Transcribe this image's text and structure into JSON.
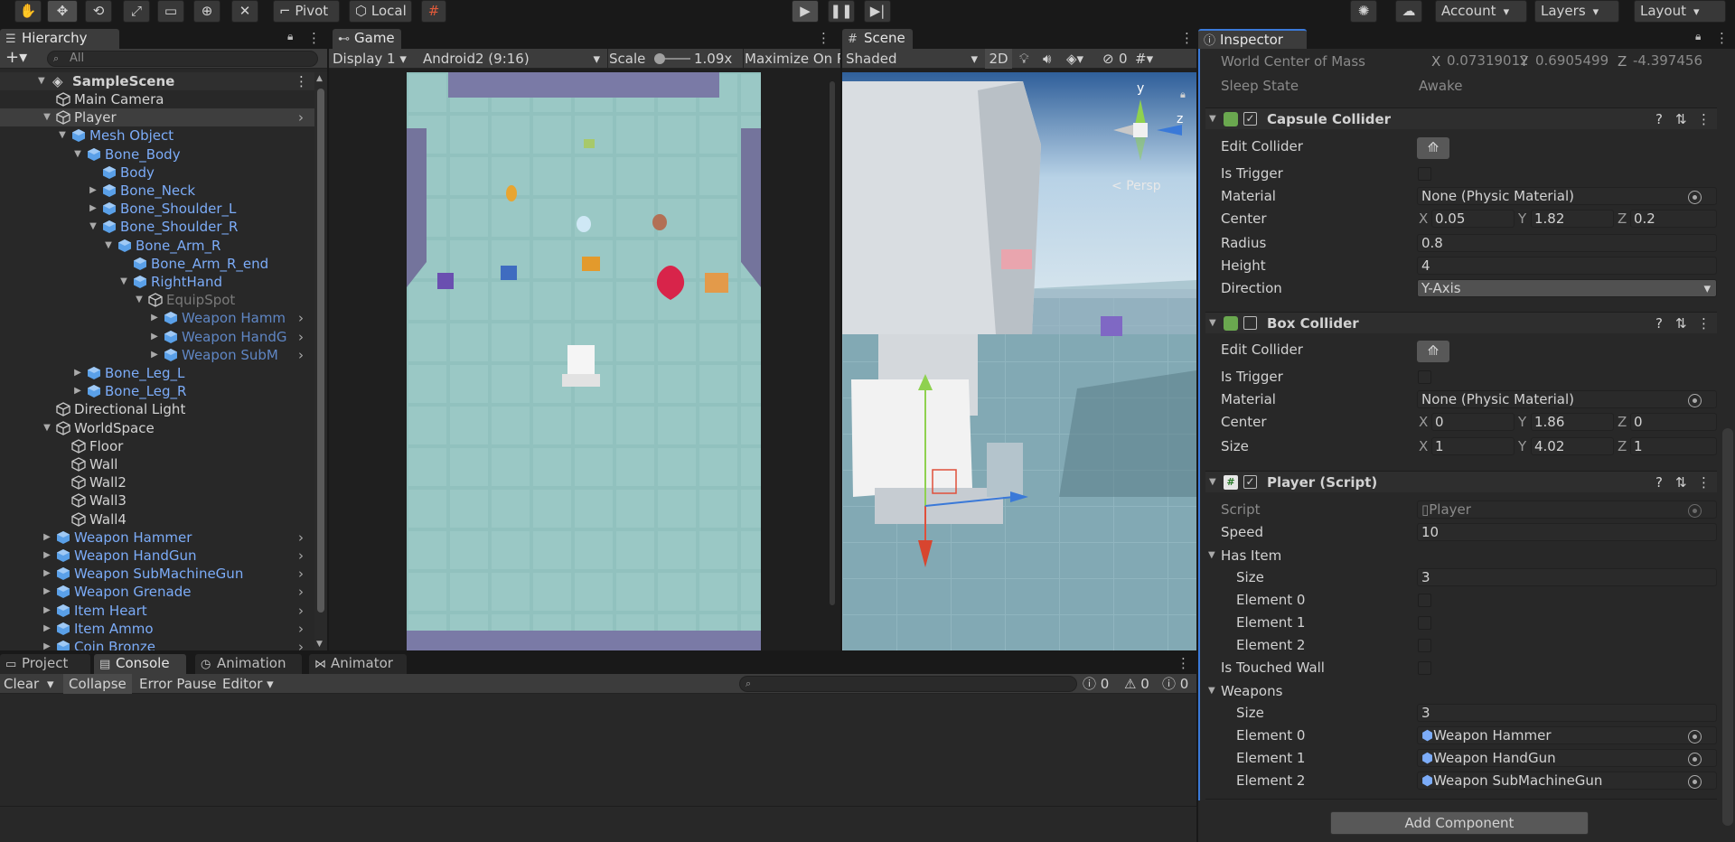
{
  "toolbar": {
    "pivot": "Pivot",
    "local": "Local",
    "account": "Account",
    "layers": "Layers",
    "layout": "Layout"
  },
  "hierarchy": {
    "tab": "Hierarchy",
    "search_placeholder": "All",
    "scene": "SampleScene",
    "rows": [
      {
        "label": "Main Camera",
        "depth": 0,
        "fold": "",
        "color": "white",
        "more": false
      },
      {
        "label": "Player",
        "depth": 0,
        "fold": "open",
        "color": "white",
        "more": true,
        "selected": true
      },
      {
        "label": "Mesh Object",
        "depth": 1,
        "fold": "open",
        "color": "blue",
        "more": false
      },
      {
        "label": "Bone_Body",
        "depth": 2,
        "fold": "open",
        "color": "blue",
        "more": false
      },
      {
        "label": "Body",
        "depth": 3,
        "fold": "",
        "color": "blue",
        "more": false
      },
      {
        "label": "Bone_Neck",
        "depth": 3,
        "fold": "closed",
        "color": "blue",
        "more": false
      },
      {
        "label": "Bone_Shoulder_L",
        "depth": 3,
        "fold": "closed",
        "color": "blue",
        "more": false
      },
      {
        "label": "Bone_Shoulder_R",
        "depth": 3,
        "fold": "open",
        "color": "blue",
        "more": false
      },
      {
        "label": "Bone_Arm_R",
        "depth": 4,
        "fold": "open",
        "color": "blue",
        "more": false
      },
      {
        "label": "Bone_Arm_R_end",
        "depth": 5,
        "fold": "",
        "color": "blue",
        "more": false
      },
      {
        "label": "RightHand",
        "depth": 5,
        "fold": "open",
        "color": "blue",
        "more": false
      },
      {
        "label": "EquipSpot",
        "depth": 6,
        "fold": "open",
        "color": "dim",
        "more": false
      },
      {
        "label": "Weapon Hamm",
        "depth": 7,
        "fold": "closed",
        "color": "bluedim",
        "more": true
      },
      {
        "label": "Weapon HandG",
        "depth": 7,
        "fold": "closed",
        "color": "bluedim",
        "more": true
      },
      {
        "label": "Weapon SubM",
        "depth": 7,
        "fold": "closed",
        "color": "bluedim",
        "more": true
      },
      {
        "label": "Bone_Leg_L",
        "depth": 2,
        "fold": "closed",
        "color": "blue",
        "more": false
      },
      {
        "label": "Bone_Leg_R",
        "depth": 2,
        "fold": "closed",
        "color": "blue",
        "more": false
      },
      {
        "label": "Directional Light",
        "depth": 0,
        "fold": "",
        "color": "white",
        "more": false
      },
      {
        "label": "WorldSpace",
        "depth": 0,
        "fold": "open",
        "color": "white",
        "more": false
      },
      {
        "label": "Floor",
        "depth": 1,
        "fold": "",
        "color": "white",
        "more": false
      },
      {
        "label": "Wall",
        "depth": 1,
        "fold": "",
        "color": "white",
        "more": false
      },
      {
        "label": "Wall2",
        "depth": 1,
        "fold": "",
        "color": "white",
        "more": false
      },
      {
        "label": "Wall3",
        "depth": 1,
        "fold": "",
        "color": "white",
        "more": false
      },
      {
        "label": "Wall4",
        "depth": 1,
        "fold": "",
        "color": "white",
        "more": false
      },
      {
        "label": "Weapon Hammer",
        "depth": 0,
        "fold": "closed",
        "color": "blue",
        "more": true
      },
      {
        "label": "Weapon HandGun",
        "depth": 0,
        "fold": "closed",
        "color": "blue",
        "more": true
      },
      {
        "label": "Weapon SubMachineGun",
        "depth": 0,
        "fold": "closed",
        "color": "blue",
        "more": true
      },
      {
        "label": "Weapon Grenade",
        "depth": 0,
        "fold": "closed",
        "color": "blue",
        "more": true
      },
      {
        "label": "Item Heart",
        "depth": 0,
        "fold": "closed",
        "color": "blue",
        "more": true
      },
      {
        "label": "Item Ammo",
        "depth": 0,
        "fold": "closed",
        "color": "blue",
        "more": true
      },
      {
        "label": "Coin Bronze",
        "depth": 0,
        "fold": "closed",
        "color": "blue",
        "more": true
      }
    ]
  },
  "game": {
    "tab": "Game",
    "display": "Display 1",
    "aspect": "Android2 (9:16)",
    "scale_label": "Scale",
    "scale_value": "1.09x",
    "maximize": "Maximize On P"
  },
  "scene_view": {
    "tab": "Scene",
    "shading": "Shaded",
    "mode_2d": "2D",
    "hidden_count": "0",
    "persp": "Persp",
    "axis_y": "y",
    "axis_z": "z"
  },
  "inspector": {
    "tab": "Inspector",
    "world_com_label": "World Center of Mass",
    "world_com": {
      "x": "0.07319012",
      "y": "0.6905499",
      "z": "-4.397456"
    },
    "sleep_label": "Sleep State",
    "sleep_value": "Awake",
    "capsule": {
      "title": "Capsule Collider",
      "edit": "Edit Collider",
      "trigger": "Is Trigger",
      "material_label": "Material",
      "material": "None (Physic Material)",
      "center_label": "Center",
      "center": {
        "x": "0.05",
        "y": "1.82",
        "z": "0.2"
      },
      "radius_label": "Radius",
      "radius": "0.8",
      "height_label": "Height",
      "height": "4",
      "direction_label": "Direction",
      "direction": "Y-Axis"
    },
    "box": {
      "title": "Box Collider",
      "edit": "Edit Collider",
      "trigger": "Is Trigger",
      "material_label": "Material",
      "material": "None (Physic Material)",
      "center_label": "Center",
      "center": {
        "x": "0",
        "y": "1.86",
        "z": "0"
      },
      "size_label": "Size",
      "size": {
        "x": "1",
        "y": "4.02",
        "z": "1"
      }
    },
    "player": {
      "title": "Player (Script)",
      "script_label": "Script",
      "script": "Player",
      "speed_label": "Speed",
      "speed": "10",
      "has_item_label": "Has Item",
      "size_label": "Size",
      "has_item_size": "3",
      "elements": [
        "Element 0",
        "Element 1",
        "Element 2"
      ],
      "touched_label": "Is Touched Wall",
      "weapons_label": "Weapons",
      "weapons_size": "3",
      "weapons": [
        "Weapon Hammer",
        "Weapon HandGun",
        "Weapon SubMachineGun"
      ]
    },
    "add_component": "Add Component"
  },
  "bottom": {
    "tabs": [
      "Project",
      "Console",
      "Animation",
      "Animator"
    ],
    "clear": "Clear",
    "collapse": "Collapse",
    "error_pause": "Error Pause",
    "editor": "Editor",
    "counts": {
      "log": "0",
      "warn": "0",
      "error": "0"
    }
  },
  "colors": {
    "accent": "#3a79d8",
    "prefab_blue": "#7cacf8",
    "panel": "#282828"
  }
}
